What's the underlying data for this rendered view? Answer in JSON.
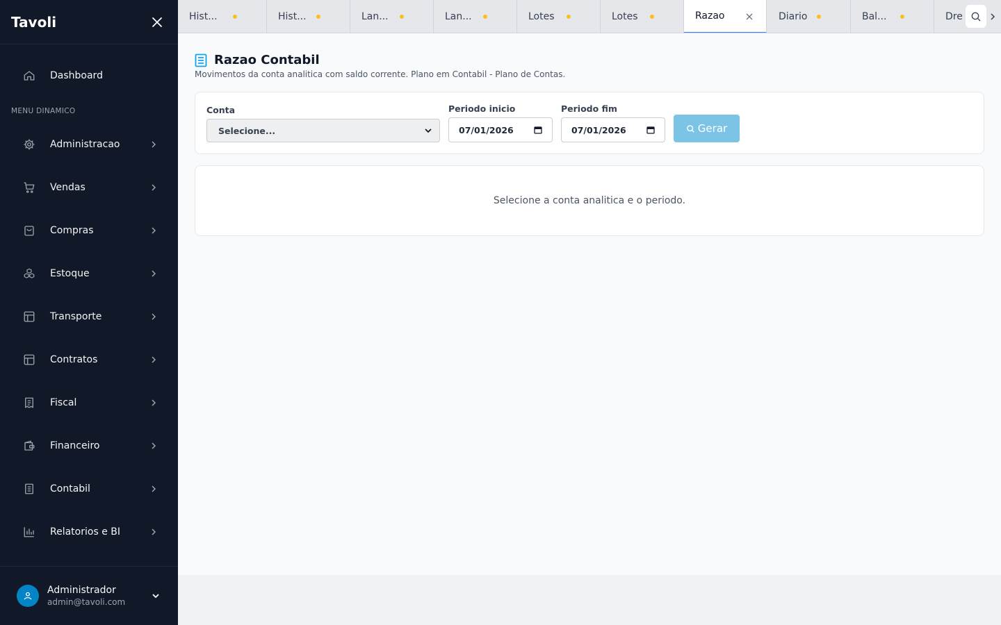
{
  "app": {
    "name": "Tavoli"
  },
  "sidebar": {
    "dashboard_label": "Dashboard",
    "section_label": "MENU DINAMICO",
    "items": [
      {
        "label": "Administracao",
        "icon": "gear-icon"
      },
      {
        "label": "Vendas",
        "icon": "cart-icon"
      },
      {
        "label": "Compras",
        "icon": "bag-icon"
      },
      {
        "label": "Estoque",
        "icon": "boxes-icon"
      },
      {
        "label": "Transporte",
        "icon": "layout-icon"
      },
      {
        "label": "Contratos",
        "icon": "layout-icon"
      },
      {
        "label": "Fiscal",
        "icon": "receipt-icon"
      },
      {
        "label": "Financeiro",
        "icon": "wallet-icon"
      },
      {
        "label": "Contabil",
        "icon": "book-icon"
      },
      {
        "label": "Relatorios e BI",
        "icon": "bar-chart-icon"
      }
    ],
    "user": {
      "name": "Administrador",
      "email": "admin@tavoli.com"
    }
  },
  "tabs": [
    {
      "label": "Hist...",
      "unsaved": true
    },
    {
      "label": "Hist...",
      "unsaved": true
    },
    {
      "label": "Lan...",
      "unsaved": true
    },
    {
      "label": "Lan...",
      "unsaved": true
    },
    {
      "label": "Lotes",
      "unsaved": true
    },
    {
      "label": "Lotes",
      "unsaved": true
    },
    {
      "label": "Razao",
      "active": true
    },
    {
      "label": "Diario",
      "unsaved": true
    },
    {
      "label": "Bal...",
      "unsaved": true
    },
    {
      "label": "Dre"
    }
  ],
  "page": {
    "title": "Razao Contabil",
    "subtitle": "Movimentos da conta analitica com saldo corrente. Plano em Contabil - Plano de Contas."
  },
  "filters": {
    "conta_label": "Conta",
    "conta_value": "Selecione...",
    "inicio_label": "Periodo inicio",
    "inicio_value": "07/01/2026",
    "fim_label": "Periodo fim",
    "fim_value": "07/01/2026",
    "gerar_label": "Gerar"
  },
  "result": {
    "empty_message": "Selecione a conta analitica e o periodo."
  },
  "colors": {
    "sidebar_bg": "#111827",
    "accent": "#3b82f6",
    "unsaved_dot": "#fbbf24",
    "button": "#7cc4e6",
    "avatar": "#0284c7"
  }
}
